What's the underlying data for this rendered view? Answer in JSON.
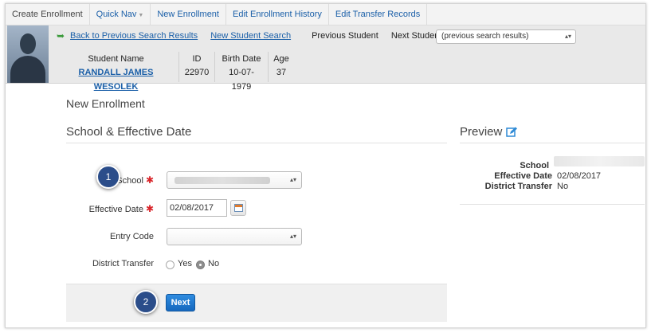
{
  "topnav": {
    "items": [
      "Create Enrollment",
      "Quick Nav",
      "New Enrollment",
      "Edit Enrollment History",
      "Edit Transfer Records"
    ]
  },
  "studentbar": {
    "back_link": "Back to Previous Search Results",
    "new_search": "New Student Search",
    "previous": "Previous Student",
    "next": "Next Student",
    "search_select": "(previous search results)",
    "headers": {
      "name": "Student Name",
      "id": "ID",
      "birth": "Birth Date",
      "age": "Age"
    },
    "values": {
      "name": "RANDALL JAMES WESOLEK",
      "id": "22970",
      "birth": "10-07-1979",
      "age": "37"
    }
  },
  "page": {
    "title": "New Enrollment",
    "section_title": "School & Effective Date"
  },
  "form": {
    "school_label": "School",
    "effective_label": "Effective Date",
    "effective_value": "02/08/2017",
    "entry_label": "Entry Code",
    "transfer_label": "District Transfer",
    "yes_label": "Yes",
    "no_label": "No",
    "transfer_selected": "No",
    "next_label": "Next"
  },
  "preview": {
    "title": "Preview",
    "school_label": "School",
    "effective_label": "Effective Date",
    "effective_value": "02/08/2017",
    "transfer_label": "District Transfer",
    "transfer_value": "No"
  },
  "callouts": [
    "1",
    "2"
  ],
  "colors": {
    "link": "#1a5fa8",
    "accent_button": "#1567be",
    "required": "#d9252a",
    "callout": "#2b4d8a"
  },
  "icons": [
    "back-arrow-icon",
    "edit-icon",
    "calendar-icon",
    "dropdown-arrows-icon",
    "required-asterisk-icon"
  ]
}
